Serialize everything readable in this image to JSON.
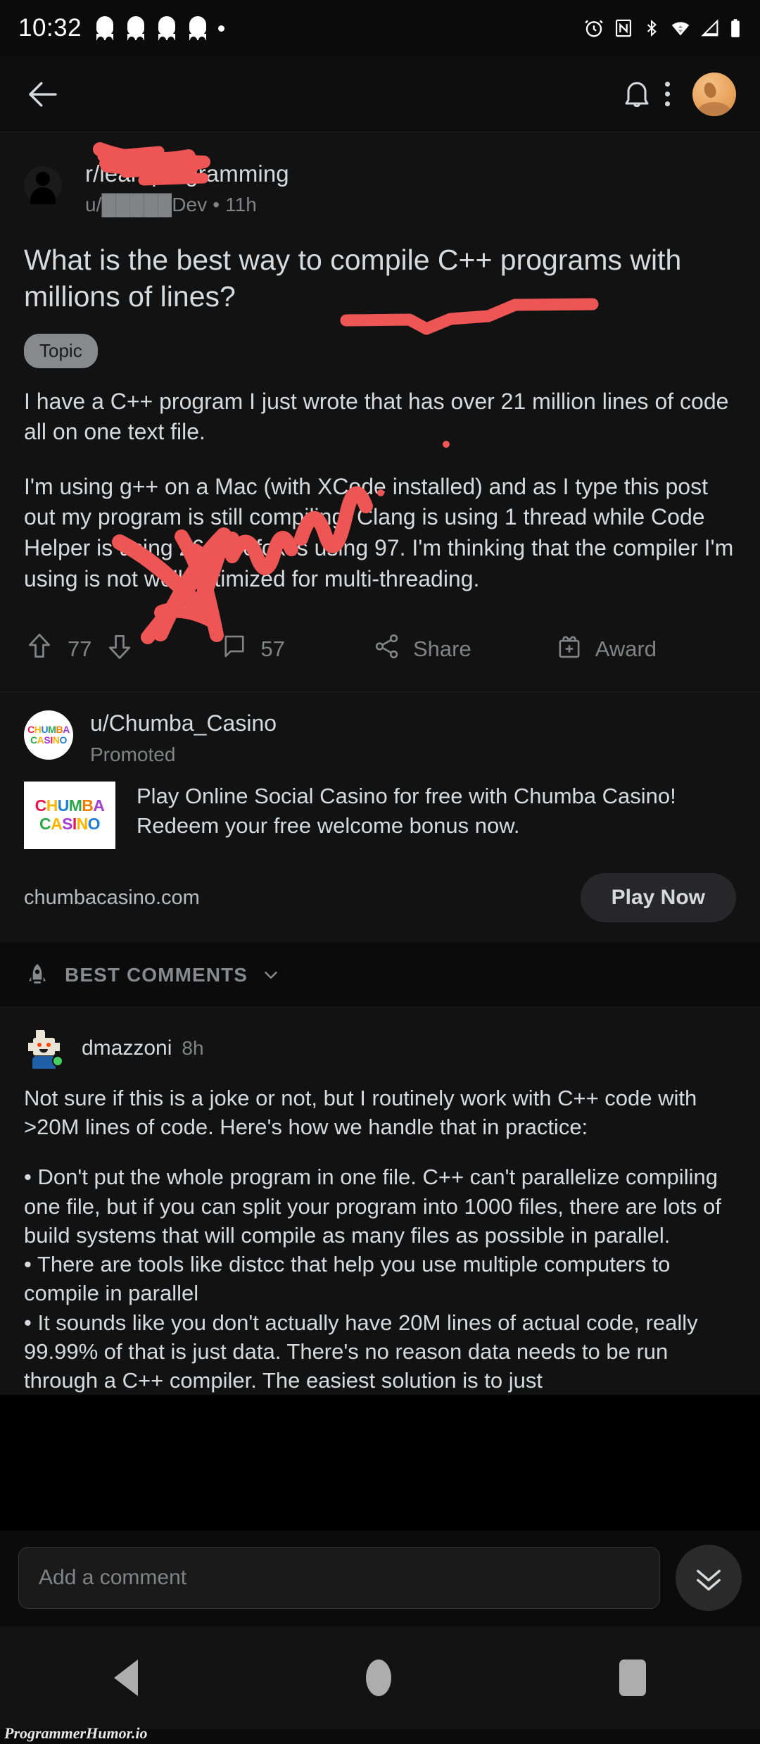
{
  "statusbar": {
    "time": "10:32",
    "left_icons": [
      "snapchat-ghost-icon",
      "snapchat-ghost-icon",
      "snapchat-ghost-pin-icon",
      "snapchat-ghost-icon",
      "dot-icon"
    ],
    "right_icons": [
      "alarm-icon",
      "nfc-icon",
      "bluetooth-icon",
      "wifi-icon",
      "signal-icon",
      "battery-icon"
    ]
  },
  "appbar": {
    "back_label": "back-arrow",
    "bell_label": "notifications",
    "overflow_label": "more-options",
    "avatar_label": "profile-avatar"
  },
  "post": {
    "subreddit": "r/learnprogramming",
    "byline": "u/█████Dev • 11h",
    "title": "What is the best way to compile C++ programs with millions of lines?",
    "flair": "Topic",
    "body_p1": "I have a C++ program I just wrote that has over 21 million lines of code all on one text file.",
    "body_p2": "I'm using g++ on a Mac (with XCode installed) and as I type this post out my program is still compiling. Clang is using 1 thread while Code Helper is using 26. Firefox is using 97. I'm thinking that the compiler I'm using is not well optimized for multi-threading.",
    "upvotes": "77",
    "comments": "57",
    "share_label": "Share",
    "award_label": "Award"
  },
  "ad": {
    "username": "u/Chumba_Casino",
    "promoted": "Promoted",
    "logo_line1": "CHUMBA",
    "logo_line2": "CASINO",
    "text": "Play Online Social Casino for free with Chumba Casino! Redeem your free welcome bonus now.",
    "url": "chumbacasino.com",
    "cta": "Play Now"
  },
  "comments_section": {
    "sort_label": "BEST COMMENTS",
    "sort_icon": "rocket-icon",
    "chevron": "chevron-down-icon"
  },
  "comment": {
    "author": "dmazzoni",
    "time": "8h",
    "p1": "Not sure if this is a joke or not, but I routinely work with C++ code with >20M lines of code. Here's how we handle that in practice:",
    "b1": "• Don't put the whole program in one file. C++ can't parallelize compiling one file, but if you can split your program into 1000 files, there are lots of build systems that will compile as many files as possible in parallel.",
    "b2": "• There are tools like distcc that help you use multiple computers to compile in parallel",
    "b3": "• It sounds like you don't actually have 20M lines of actual code, really 99.99% of that is just data. There's no reason data needs to be run through a C++ compiler. The easiest solution is to just"
  },
  "composer": {
    "placeholder": "Add a comment",
    "value": "",
    "jump_icon": "double-chevron-down-icon"
  },
  "navbar": {
    "back": "nav-back-icon",
    "home": "nav-home-icon",
    "recent": "nav-recent-icon"
  },
  "watermark": {
    "text": "ProgrammerHumor.io"
  },
  "colors": {
    "background": "#000000",
    "surface": "#121212",
    "text_primary": "#d7dadc",
    "text_secondary": "#818384",
    "annotation_red": "#ee5555",
    "online_green": "#46d160",
    "upvote_orange": "#ff4500"
  }
}
